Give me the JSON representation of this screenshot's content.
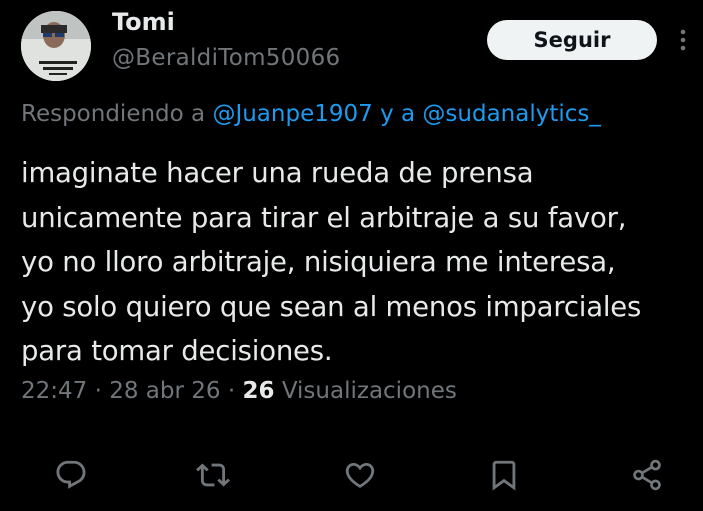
{
  "author": {
    "display_name": "Tomi",
    "handle": "@BeraldiTom50066"
  },
  "follow_button": {
    "label": "Seguir"
  },
  "reply": {
    "prefix": "Respondiendo a",
    "mention1": "@Juanpe1907",
    "conjunction": "y a",
    "mention2": "@sudanalytics_"
  },
  "tweet": {
    "lines": [
      "imaginate hacer una rueda de prensa",
      "unicamente para tirar el arbitraje a su favor,",
      "yo no lloro arbitraje, nisiquiera me interesa,",
      "yo solo quiero que sean al menos imparciales",
      "para tomar decisiones."
    ]
  },
  "meta": {
    "time": "22:47",
    "separator": "·",
    "date": "28 abr 26",
    "views_count": "26",
    "views_label": "Visualizaciones"
  },
  "actions": {
    "reply_icon": "speech-bubble",
    "retweet_icon": "retweet-arrows",
    "like_icon": "heart",
    "bookmark_icon": "bookmark",
    "share_icon": "share-nodes"
  },
  "colors": {
    "background": "#000000",
    "text": "#e7e9ea",
    "secondary": "#71767b",
    "link": "#1d9bf0",
    "button_bg": "#eff3f4"
  }
}
